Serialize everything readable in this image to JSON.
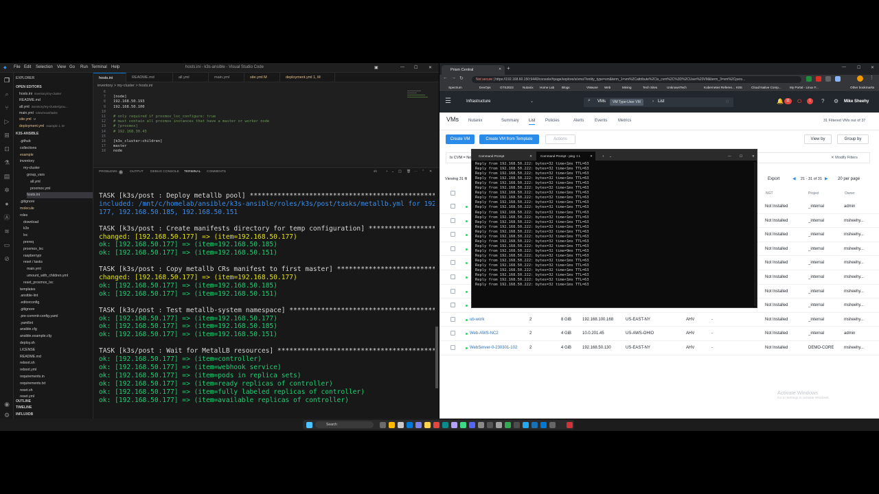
{
  "vscode": {
    "menu": [
      "File",
      "Edit",
      "Selection",
      "View",
      "Go",
      "Run",
      "Terminal",
      "Help"
    ],
    "window_title": "hosts.ini - k3s-ansible - Visual Studio Code",
    "explorer_label": "EXPLORER",
    "open_editors_label": "OPEN EDITORS",
    "open_editors": [
      {
        "name": "hosts.ini",
        "desc": "inventory/my-cluster"
      },
      {
        "name": "README.md",
        "desc": ""
      },
      {
        "name": "all.yml",
        "desc": "inventory/my-cluster/grou..."
      },
      {
        "name": "main.yml",
        "desc": "roles/reset/tasks"
      },
      {
        "name": "site.yml",
        "desc": "M"
      },
      {
        "name": "deployment.yml",
        "desc": "example  1, M"
      }
    ],
    "project_label": "K3S-ANSIBLE",
    "tree": [
      ".github",
      "collections",
      "example",
      "inventory",
      "my-cluster",
      "group_vars",
      "all.yml",
      "proxmox.yml",
      "hosts.ini",
      ".gitignore",
      "molecule",
      "roles",
      "download",
      "k3s",
      "lxc",
      "prereq",
      "proxmox_lxc",
      "raspberrypi",
      "reset / tasks",
      "main.yml",
      "umount_with_children.yml",
      "reset_proxmox_lxc",
      "templates",
      ".ansible-lint",
      ".editorconfig",
      ".gitignore",
      ".pre-commit-config.yaml",
      ".yamllint",
      "ansible.cfg",
      "ansible.example.cfg",
      "deploy.sh",
      "LICENSE",
      "README.md",
      "reboot.sh",
      "reboot.yml",
      "requirements.in",
      "requirements.txt",
      "reset.sh",
      "reset.yml"
    ],
    "outline_label": "OUTLINE",
    "timeline_label": "TIMELINE",
    "influxdb_label": "INFLUXDB",
    "tabs": [
      "hosts.ini",
      "README.md",
      "all.yml",
      "main.yml",
      "site.yml  M",
      "deployment.yml  1, M"
    ],
    "breadcrumb": "inventory > my-cluster > hosts.ini",
    "code_lines": [
      {
        "n": "6",
        "t": "",
        "c": false
      },
      {
        "n": "7",
        "t": "[node]",
        "c": false
      },
      {
        "n": "8",
        "t": "192.168.50.193",
        "c": false
      },
      {
        "n": "9",
        "t": "192.168.50.100",
        "c": false
      },
      {
        "n": "10",
        "t": "",
        "c": false
      },
      {
        "n": "11",
        "t": "# only required if proxmox_lxc_configure: true",
        "c": true
      },
      {
        "n": "12",
        "t": "# must contain all proxmox instances that have a master or worker node",
        "c": true
      },
      {
        "n": "13",
        "t": "# [proxmox]",
        "c": true
      },
      {
        "n": "14",
        "t": "# 192.168.30.43",
        "c": true
      },
      {
        "n": "15",
        "t": "",
        "c": false
      },
      {
        "n": "16",
        "t": "[k3s_cluster:children]",
        "c": false
      },
      {
        "n": "17",
        "t": "master",
        "c": false
      },
      {
        "n": "18",
        "t": "node",
        "c": false
      }
    ],
    "panel_tabs": [
      "PROBLEMS",
      "OUTPUT",
      "DEBUG CONSOLE",
      "TERMINAL",
      "COMMENTS"
    ],
    "problems_count": "1",
    "terminal_shell": "sh",
    "terminal_lines": [
      {
        "t": "TASK [k3s/post : Deploy metallb pool] ****************************************************",
        "k": "w"
      },
      {
        "t": "included: /mnt/c/homelab/ansible/k3s-ansible/roles/k3s/post/tasks/metallb.yml for 192.168.50.",
        "k": "b"
      },
      {
        "t": "177, 192.168.50.185, 192.168.50.151",
        "k": "b"
      },
      {
        "t": "",
        "k": "w"
      },
      {
        "t": "TASK [k3s/post : Create manifests directory for temp configuration] **********************",
        "k": "w"
      },
      {
        "t": "changed: [192.168.50.177] => (item=192.168.50.177)",
        "k": "y"
      },
      {
        "t": "ok: [192.168.50.177] => (item=192.168.50.185)",
        "k": "g"
      },
      {
        "t": "ok: [192.168.50.177] => (item=192.168.50.151)",
        "k": "g"
      },
      {
        "t": "",
        "k": "w"
      },
      {
        "t": "TASK [k3s/post : Copy metallb CRs manifest to first master] ******************************",
        "k": "w"
      },
      {
        "t": "changed: [192.168.50.177] => (item=192.168.50.177)",
        "k": "y"
      },
      {
        "t": "ok: [192.168.50.177] => (item=192.168.50.185)",
        "k": "g"
      },
      {
        "t": "ok: [192.168.50.177] => (item=192.168.50.151)",
        "k": "g"
      },
      {
        "t": "",
        "k": "w"
      },
      {
        "t": "TASK [k3s/post : Test metallb-system namespace] ******************************************",
        "k": "w"
      },
      {
        "t": "ok: [192.168.50.177] => (item=192.168.50.177)",
        "k": "g"
      },
      {
        "t": "ok: [192.168.50.177] => (item=192.168.50.185)",
        "k": "g"
      },
      {
        "t": "ok: [192.168.50.177] => (item=192.168.50.151)",
        "k": "g"
      },
      {
        "t": "",
        "k": "w"
      },
      {
        "t": "TASK [k3s/post : Wait for MetalLB resources] *********************************************",
        "k": "w"
      },
      {
        "t": "ok: [192.168.50.177] => (item=controller)",
        "k": "g"
      },
      {
        "t": "ok: [192.168.50.177] => (item=webhook service)",
        "k": "g"
      },
      {
        "t": "ok: [192.168.50.177] => (item=pods in replica sets)",
        "k": "g"
      },
      {
        "t": "ok: [192.168.50.177] => (item=ready replicas of controller)",
        "k": "g"
      },
      {
        "t": "ok: [192.168.50.177] => (item=fully labeled replicas of controller)",
        "k": "g"
      },
      {
        "t": "ok: [192.168.50.177] => (item=available replicas of controller)",
        "k": "g"
      }
    ]
  },
  "browser": {
    "tab_title": "Prism Central",
    "url_prefix": "Not secure",
    "url": "https://192.168.60.150:9440/console/#page/explore/s/vms/?entity_type=vm&term_1=vm%2Cattribute%2Cis_cvm%2C%3D%2CUser%20VM&term_3=vm%2Cpers...",
    "bookmarks": [
      "Spectrum",
      "DevOps",
      "GTS2023",
      "Nutanix",
      "Home Lab",
      "Blogs",
      "VMware",
      "Web",
      "Mining",
      "Tech Sites",
      "UnknownTech",
      "Kubernetes Referen...",
      "K8S",
      "Cloud Native Comp...",
      "My Portal - Linux F...",
      "Other bookmarks"
    ]
  },
  "prism": {
    "menu_label": "Infrastructure",
    "search_category": "VMs",
    "search_pill": "VM Type-User VM",
    "search_scope": "List",
    "alert_count_1": "11",
    "alert_count_2": "1",
    "user": "Mike Sheehy",
    "page_title": "VMs",
    "nav": [
      "Nutanix",
      "Summary",
      "List",
      "Policies",
      "Alerts",
      "Events",
      "Metrics"
    ],
    "filtered_count": "31 Filtered VMs out of 37",
    "create_vm": "Create VM",
    "create_from_template": "Create VM from Template",
    "actions": "Actions",
    "view_by": "View by",
    "group_by": "Group by",
    "filter_chip": "Is CVM = No",
    "modify_filters": "Modify Filters",
    "viewing": "Viewing 31 fil",
    "export": "Export",
    "pager": "21 - 31 of 31",
    "per_page": "20 per page",
    "columns": {
      "ngt": "NGT",
      "project": "Project",
      "owner": "Owner"
    },
    "rows": [
      {
        "name": "",
        "cpu": "",
        "mem": "",
        "ip": "",
        "cluster": "",
        "hyp": "",
        "ngt": "Not Installed",
        "project": "_internal",
        "owner": "admin"
      },
      {
        "name": "",
        "cpu": "",
        "mem": "",
        "ip": "",
        "cluster": "",
        "hyp": "",
        "ngt": "Not Installed",
        "project": "_internal",
        "owner": "msheehy..."
      },
      {
        "name": "",
        "cpu": "",
        "mem": "",
        "ip": "",
        "cluster": "",
        "hyp": "",
        "ngt": "Not Installed",
        "project": "_internal",
        "owner": "msheehy..."
      },
      {
        "name": "",
        "cpu": "",
        "mem": "",
        "ip": "",
        "cluster": "",
        "hyp": "",
        "ngt": "Not Installed",
        "project": "_internal",
        "owner": "msheehy..."
      },
      {
        "name": "",
        "cpu": "",
        "mem": "",
        "ip": "",
        "cluster": "",
        "hyp": "",
        "ngt": "Not Installed",
        "project": "_internal",
        "owner": "msheehy..."
      },
      {
        "name": "",
        "cpu": "",
        "mem": "",
        "ip": "",
        "cluster": "",
        "hyp": "",
        "ngt": "Not Installed",
        "project": "_internal",
        "owner": "msheehy..."
      },
      {
        "name": "",
        "cpu": "",
        "mem": "",
        "ip": "",
        "cluster": "",
        "hyp": "",
        "ngt": "Not Installed",
        "project": "_internal",
        "owner": "msheehy..."
      },
      {
        "name": "",
        "cpu": "",
        "mem": "",
        "ip": "",
        "cluster": "",
        "hyp": "",
        "ngt": "Not Installed",
        "project": "_internal",
        "owner": "msheehy..."
      },
      {
        "name": "ub-work",
        "cpu": "2",
        "mem": "8 GiB",
        "ip": "192.168.100.168",
        "cluster": "US-EAST-NY",
        "hyp": "AHV",
        "ngt": "Not Installed",
        "project": "_internal",
        "owner": "msheehy..."
      },
      {
        "name": "Web-AWS-NC2",
        "cpu": "2",
        "mem": "4 GiB",
        "ip": "10.0.201.45",
        "cluster": "US-AWS-OHIO",
        "hyp": "AHV",
        "ngt": "Not Installed",
        "project": "_internal",
        "owner": "admin"
      },
      {
        "name": "WebServer-0-230301-102",
        "cpu": "2",
        "mem": "4 GiB",
        "ip": "192.168.50.130",
        "cluster": "US-EAST-NY",
        "hyp": "AHV",
        "ngt": "Not Installed",
        "project": "DEMO-CORE",
        "owner": "msheehy..."
      }
    ],
    "dash": "-"
  },
  "cmd": {
    "tab1": "Command Prompt",
    "tab2": "Command Prompt - ping  -t 1",
    "reply_line": "Reply from 192.168.50.222: bytes=32 time<1ms TTL=63",
    "reply_line_alt": "Reply from 192.168.50.222: bytes=32 time=9ms TTL=63",
    "line_count": 26
  },
  "windows": {
    "watermark_title": "Activate Windows",
    "watermark_sub": "Go to Settings to activate Windows.",
    "search": "Search"
  },
  "colors": {
    "vscode_accent": "#0078d4",
    "prism_blue": "#2a8ce8",
    "terminal_green": "#1ecf74",
    "terminal_yellow": "#e5e510"
  }
}
